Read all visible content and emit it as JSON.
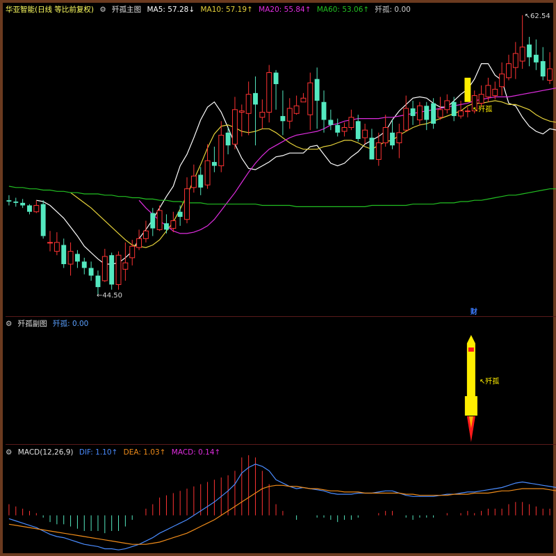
{
  "main_header": {
    "stock": "华亚智能(日线 等比前复权)",
    "indicator": "歼孤主图",
    "ma5": "MA5: 57.28↓",
    "ma10": "MA10: 57.19↑",
    "ma20": "MA20: 55.84↑",
    "ma60": "MA60: 53.06↑",
    "signal": "歼孤: 0.00"
  },
  "sub_header": {
    "indicator": "歼孤副图",
    "signal": "歼孤: 0.00"
  },
  "macd_header": {
    "name": "MACD(12,26,9)",
    "dif": "DIF: 1.10↑",
    "dea": "DEA: 1.03↑",
    "macd": "MACD: 0.14↑"
  },
  "labels": {
    "high": "62.54",
    "low": "44.50",
    "signal_main": "↖歼孤",
    "signal_sub": "↖歼孤",
    "cai": "财"
  },
  "colors": {
    "up": "#ff3333",
    "down": "#54e8c0",
    "ma5": "#ffffff",
    "ma10": "#e6d23a",
    "ma20": "#e02de0",
    "ma60": "#22c022",
    "dif": "#4a8cff",
    "dea": "#f08c1a",
    "signal": "#ffee00",
    "border": "#6b3a1f"
  },
  "chart_data": [
    {
      "type": "candlestick",
      "title": "歼孤主图",
      "series": [
        {
          "name": "MA5",
          "values": [
            null,
            null,
            null,
            null,
            51.9,
            51.8,
            51.5,
            51.0,
            50.5,
            49.8,
            49.1,
            48.3,
            47.8,
            47.3,
            46.9,
            46.9,
            47.0,
            47.4,
            47.9,
            48.9,
            49.6,
            50.4,
            51.3,
            52.2,
            53.0,
            54.6,
            55.5,
            56.8,
            58.2,
            59.2,
            59.6,
            58.8,
            57.6,
            56.3,
            55.2,
            54.4,
            54.3,
            54.6,
            54.9,
            55.3,
            55.4,
            55.6,
            55.6,
            55.6,
            56.1,
            56.2,
            55.5,
            54.8,
            54.6,
            54.8,
            55.3,
            55.7,
            56.3,
            56.6,
            56.9,
            57.3,
            58.2,
            58.9,
            59.4,
            59.9,
            60.0,
            59.9,
            59.5,
            59.2,
            59.2,
            59.7,
            60.2,
            60.6,
            61.4,
            62.6,
            62.6,
            61.7,
            61.3,
            59.5,
            59.3,
            58.4,
            57.7,
            57.3,
            57.1,
            57.5,
            57.4,
            57.5,
            57.4,
            57.4,
            57.5
          ]
        },
        {
          "name": "MA10",
          "values": [
            null,
            null,
            null,
            null,
            null,
            null,
            null,
            null,
            null,
            52.5,
            52.1,
            51.7,
            51.3,
            50.8,
            50.3,
            49.8,
            49.3,
            48.8,
            48.4,
            48.3,
            48.2,
            48.4,
            48.8,
            49.5,
            50.2,
            51.2,
            52.3,
            53.5,
            54.7,
            56.0,
            57.1,
            57.7,
            57.8,
            57.6,
            57.3,
            57.2,
            57.3,
            57.5,
            57.5,
            57.2,
            56.8,
            56.4,
            56.1,
            55.9,
            55.9,
            55.9,
            56.1,
            56.2,
            56.4,
            56.6,
            56.6,
            56.4,
            56.1,
            55.9,
            56.2,
            56.5,
            56.6,
            57.0,
            57.3,
            57.6,
            57.8,
            57.9,
            58.1,
            58.3,
            58.5,
            58.7,
            58.9,
            59.3,
            59.5,
            59.5,
            59.6,
            59.7,
            59.6,
            59.4,
            59.4,
            59.2,
            59.0,
            58.6,
            58.3,
            58.1,
            58.0,
            57.9,
            57.9,
            57.9,
            57.6
          ]
        },
        {
          "name": "MA20",
          "values": [
            null,
            null,
            null,
            null,
            null,
            null,
            null,
            null,
            null,
            null,
            null,
            null,
            null,
            null,
            null,
            null,
            null,
            null,
            null,
            51.9,
            51.3,
            50.8,
            50.3,
            49.9,
            49.5,
            49.3,
            49.3,
            49.4,
            49.6,
            49.9,
            50.4,
            51.1,
            51.8,
            52.5,
            53.3,
            54.1,
            54.8,
            55.4,
            55.9,
            56.2,
            56.5,
            56.8,
            57.0,
            57.1,
            57.2,
            57.3,
            57.5,
            57.8,
            57.9,
            58.1,
            58.2,
            58.3,
            58.3,
            58.3,
            58.3,
            58.4,
            58.4,
            58.5,
            58.6,
            58.7,
            58.8,
            58.9,
            59.0,
            59.1,
            59.2,
            59.3,
            59.4,
            59.5,
            59.7,
            59.8,
            59.9,
            60.0,
            60.0,
            60.0,
            60.1,
            60.2,
            60.3,
            60.4,
            60.5,
            60.6,
            60.7,
            60.8,
            60.9,
            61.0,
            61.0
          ]
        },
        {
          "name": "MA60",
          "values": [
            53.0,
            52.9,
            52.9,
            52.8,
            52.8,
            52.7,
            52.7,
            52.6,
            52.6,
            52.5,
            52.5,
            52.4,
            52.4,
            52.4,
            52.3,
            52.3,
            52.2,
            52.2,
            52.1,
            52.1,
            52.0,
            52.0,
            51.9,
            51.9,
            51.8,
            51.8,
            51.7,
            51.7,
            51.7,
            51.6,
            51.6,
            51.6,
            51.6,
            51.6,
            51.6,
            51.6,
            51.6,
            51.5,
            51.5,
            51.5,
            51.5,
            51.5,
            51.4,
            51.4,
            51.4,
            51.4,
            51.4,
            51.4,
            51.4,
            51.4,
            51.4,
            51.4,
            51.4,
            51.5,
            51.5,
            51.5,
            51.5,
            51.5,
            51.5,
            51.6,
            51.6,
            51.6,
            51.6,
            51.7,
            51.7,
            51.7,
            51.8,
            51.8,
            51.9,
            51.9,
            52.0,
            52.1,
            52.2,
            52.3,
            52.3,
            52.4,
            52.5,
            52.6,
            52.7,
            52.8,
            52.8,
            52.9,
            53.0,
            53.0,
            53.1
          ]
        }
      ],
      "candles": [
        [
          51.9,
          51.8,
          52.3,
          51.5
        ],
        [
          51.8,
          51.7,
          52.1,
          51.4
        ],
        [
          51.7,
          51.5,
          52.0,
          51.3
        ],
        [
          51.5,
          51.0,
          51.6,
          50.8
        ],
        [
          51.0,
          51.5,
          51.9,
          50.9
        ],
        [
          51.6,
          49.1,
          51.9,
          48.9
        ],
        [
          48.6,
          48.6,
          49.5,
          47.9
        ],
        [
          47.9,
          48.6,
          49.4,
          47.6
        ],
        [
          48.4,
          46.9,
          48.9,
          46.6
        ],
        [
          46.9,
          47.9,
          48.6,
          46.0
        ],
        [
          47.7,
          47.1,
          48.0,
          46.6
        ],
        [
          47.1,
          46.6,
          47.4,
          46.1
        ],
        [
          46.6,
          46.0,
          47.1,
          45.6
        ],
        [
          46.0,
          45.1,
          46.4,
          44.5
        ],
        [
          45.6,
          47.5,
          48.1,
          45.5
        ],
        [
          47.6,
          45.3,
          47.8,
          44.9
        ],
        [
          45.3,
          47.6,
          47.9,
          44.9
        ],
        [
          46.5,
          47.0,
          48.6,
          45.6
        ],
        [
          47.4,
          48.3,
          48.8,
          46.8
        ],
        [
          48.2,
          48.9,
          49.6,
          48.0
        ],
        [
          48.9,
          49.5,
          50.3,
          48.6
        ],
        [
          50.9,
          49.7,
          51.3,
          49.1
        ],
        [
          49.6,
          51.1,
          51.5,
          49.5
        ],
        [
          50.1,
          49.6,
          50.8,
          49.3
        ],
        [
          49.7,
          50.3,
          51.0,
          49.4
        ],
        [
          51.0,
          50.6,
          51.5,
          49.9
        ],
        [
          50.4,
          52.8,
          53.7,
          50.1
        ],
        [
          52.9,
          53.8,
          54.7,
          52.5
        ],
        [
          53.9,
          52.9,
          54.5,
          52.3
        ],
        [
          53.1,
          55.0,
          56.3,
          52.8
        ],
        [
          54.9,
          54.6,
          56.1,
          54.1
        ],
        [
          54.6,
          57.0,
          58.1,
          54.1
        ],
        [
          57.2,
          56.2,
          57.6,
          55.5
        ],
        [
          56.3,
          59.0,
          60.0,
          55.9
        ],
        [
          58.8,
          58.9,
          59.4,
          56.9
        ],
        [
          58.7,
          60.2,
          61.2,
          57.0
        ],
        [
          60.3,
          59.4,
          61.6,
          56.2
        ],
        [
          58.4,
          58.8,
          59.8,
          57.5
        ],
        [
          58.8,
          61.9,
          62.5,
          58.0
        ],
        [
          61.9,
          61.0,
          62.1,
          59.0
        ],
        [
          58.5,
          58.1,
          60.5,
          57.0
        ],
        [
          58.1,
          59.1,
          59.9,
          57.5
        ],
        [
          58.7,
          59.3,
          60.1,
          58.6
        ],
        [
          59.6,
          59.9,
          60.3,
          59.6
        ],
        [
          58.6,
          61.1,
          61.9,
          57.4
        ],
        [
          61.4,
          59.7,
          62.3,
          57.5
        ],
        [
          59.6,
          58.2,
          60.5,
          57.2
        ],
        [
          58.2,
          57.8,
          59.0,
          57.4
        ],
        [
          57.8,
          57.2,
          58.3,
          56.9
        ],
        [
          57.3,
          57.6,
          58.0,
          56.9
        ],
        [
          57.6,
          58.4,
          59.0,
          57.4
        ],
        [
          58.1,
          56.7,
          58.6,
          56.5
        ],
        [
          56.8,
          57.4,
          57.9,
          56.3
        ],
        [
          56.8,
          55.1,
          57.5,
          55.1
        ],
        [
          55.1,
          56.4,
          57.2,
          54.6
        ],
        [
          56.4,
          57.6,
          58.6,
          56.1
        ],
        [
          57.2,
          56.2,
          58.2,
          55.9
        ],
        [
          56.4,
          57.2,
          57.9,
          55.2
        ],
        [
          57.4,
          59.1,
          60.1,
          57.3
        ],
        [
          59.1,
          58.5,
          59.7,
          57.8
        ],
        [
          58.2,
          59.3,
          59.6,
          57.8
        ],
        [
          59.3,
          58.2,
          59.6,
          57.4
        ],
        [
          59.5,
          57.9,
          59.9,
          57.5
        ],
        [
          58.4,
          59.0,
          60.0,
          58.2
        ],
        [
          59.0,
          59.7,
          60.2,
          58.7
        ],
        [
          59.6,
          58.5,
          60.0,
          58.1
        ],
        [
          58.5,
          58.9,
          59.7,
          58.3
        ],
        [
          58.9,
          58.9,
          59.2,
          58.4
        ],
        [
          58.9,
          60.1,
          60.5,
          58.7
        ],
        [
          59.5,
          60.2,
          60.9,
          59.2
        ],
        [
          60.0,
          60.9,
          61.5,
          59.6
        ],
        [
          60.1,
          60.6,
          61.2,
          59.8
        ],
        [
          60.8,
          61.8,
          62.7,
          60.1
        ],
        [
          61.5,
          62.6,
          63.3,
          61.3
        ],
        [
          62.3,
          63.4,
          64.3,
          61.4
        ],
        [
          62.8,
          63.9,
          66.4,
          62.2
        ],
        [
          64.1,
          63.1,
          64.7,
          62.4
        ],
        [
          63.3,
          62.7,
          64.5,
          62.1
        ],
        [
          62.8,
          61.6,
          63.9,
          61.3
        ],
        [
          61.3,
          62.2,
          63.5,
          61.0
        ]
      ],
      "high_label": 62.54,
      "low_label": 44.5,
      "signal_bar": [
        61.5,
        59.6
      ],
      "ylim": [
        43.2,
        66.5
      ]
    },
    {
      "type": "bar",
      "title": "MACD(12,26,9)",
      "series": [
        {
          "name": "DIF",
          "values": [
            -0.15,
            -0.25,
            -0.35,
            -0.45,
            -0.55,
            -0.7,
            -0.85,
            -0.95,
            -1.0,
            -1.1,
            -1.2,
            -1.3,
            -1.35,
            -1.4,
            -1.5,
            -1.5,
            -1.55,
            -1.5,
            -1.4,
            -1.3,
            -1.15,
            -1.0,
            -0.8,
            -0.65,
            -0.5,
            -0.35,
            -0.2,
            0.0,
            0.2,
            0.4,
            0.6,
            0.85,
            1.1,
            1.4,
            1.9,
            2.15,
            2.3,
            2.2,
            2.0,
            1.6,
            1.45,
            1.3,
            1.2,
            1.25,
            1.2,
            1.15,
            1.1,
            1.0,
            0.95,
            0.95,
            0.95,
            1.0,
            1.0,
            1.0,
            1.05,
            1.1,
            1.1,
            1.0,
            0.9,
            0.85,
            0.85,
            0.85,
            0.85,
            0.9,
            0.95,
            0.95,
            1.0,
            1.05,
            1.05,
            1.1,
            1.15,
            1.2,
            1.25,
            1.35,
            1.45,
            1.5,
            1.45,
            1.4,
            1.35,
            1.3,
            1.25,
            1.2,
            1.15,
            1.1
          ]
        },
        {
          "name": "DEA",
          "values": [
            -0.4,
            -0.45,
            -0.5,
            -0.55,
            -0.6,
            -0.65,
            -0.7,
            -0.75,
            -0.8,
            -0.85,
            -0.9,
            -0.95,
            -1.0,
            -1.05,
            -1.1,
            -1.15,
            -1.2,
            -1.25,
            -1.3,
            -1.3,
            -1.3,
            -1.25,
            -1.2,
            -1.1,
            -1.0,
            -0.9,
            -0.8,
            -0.65,
            -0.5,
            -0.35,
            -0.2,
            0.0,
            0.2,
            0.4,
            0.6,
            0.8,
            1.0,
            1.2,
            1.3,
            1.35,
            1.35,
            1.3,
            1.3,
            1.25,
            1.2,
            1.2,
            1.15,
            1.1,
            1.1,
            1.05,
            1.05,
            1.05,
            1.0,
            1.0,
            1.0,
            1.0,
            1.0,
            1.0,
            0.95,
            0.95,
            0.9,
            0.9,
            0.9,
            0.9,
            0.9,
            0.95,
            0.95,
            0.95,
            1.0,
            1.0,
            1.0,
            1.05,
            1.1,
            1.1,
            1.15,
            1.2,
            1.2,
            1.2,
            1.2,
            1.15,
            1.1,
            1.1,
            1.05,
            1.03
          ]
        },
        {
          "name": "MACD",
          "values": [
            0.5,
            0.4,
            0.3,
            0.2,
            0.1,
            -0.1,
            -0.3,
            -0.4,
            -0.4,
            -0.5,
            -0.6,
            -0.7,
            -0.7,
            -0.7,
            -0.8,
            -0.7,
            -0.7,
            -0.5,
            -0.2,
            0.0,
            0.3,
            0.5,
            0.8,
            0.9,
            1.0,
            1.1,
            1.2,
            1.3,
            1.4,
            1.5,
            1.6,
            1.7,
            1.8,
            2.0,
            2.6,
            2.7,
            2.6,
            2.0,
            1.4,
            0.5,
            0.2,
            0.0,
            -0.2,
            0.0,
            0.0,
            -0.1,
            -0.1,
            -0.2,
            -0.3,
            -0.2,
            -0.2,
            -0.1,
            0.0,
            0.0,
            0.1,
            0.2,
            0.2,
            0.0,
            -0.1,
            -0.2,
            -0.1,
            -0.1,
            -0.1,
            0.0,
            0.1,
            0.0,
            0.1,
            0.2,
            0.1,
            0.2,
            0.3,
            0.3,
            0.3,
            0.5,
            0.6,
            0.6,
            0.5,
            0.4,
            0.3,
            0.3,
            0.3,
            0.2,
            0.2,
            0.14
          ]
        }
      ],
      "ylim": [
        -1.7,
        2.7
      ]
    }
  ]
}
